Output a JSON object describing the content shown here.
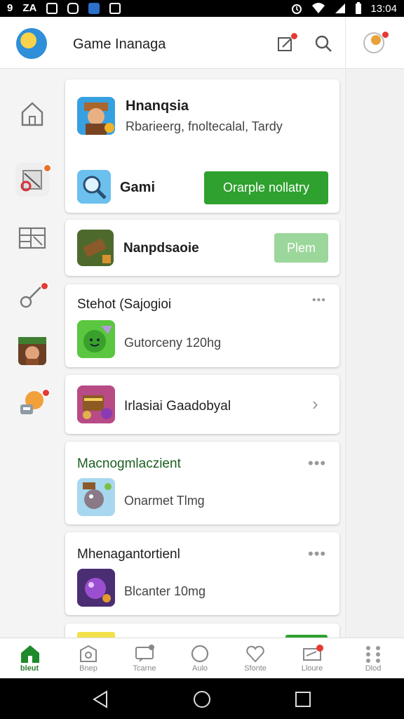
{
  "status_bar": {
    "time": "13:04",
    "left_glyphs": [
      "9",
      "ZA"
    ]
  },
  "app_bar": {
    "title": "Game Inanaga"
  },
  "cards": [
    {
      "title": "Hnanqsia",
      "subtitle": "Rbarieerg, fnoltecalal, Tardy",
      "row2_label": "Gami",
      "button": "Orarple nollatry"
    },
    {
      "title": "Nanpdsaoie",
      "button": "Plem"
    },
    {
      "header": "Stehot (Sajogioi",
      "line": "Gutorceny 120hg"
    },
    {
      "line": "Irlasiai Gaadobyal"
    },
    {
      "header": "Macnogmlaczient",
      "line": "Onarmet Tlmg"
    },
    {
      "header": "Mhenagantortienl",
      "line": "Blcanter 10mg"
    }
  ],
  "bottom_nav": {
    "items": [
      {
        "label": "bleut",
        "icon": "home-icon",
        "active": true
      },
      {
        "label": "Bnep",
        "icon": "store-icon"
      },
      {
        "label": "Tcarne",
        "icon": "message-icon"
      },
      {
        "label": "Aulo",
        "icon": "circle-icon"
      },
      {
        "label": "Sfonte",
        "icon": "heart-icon"
      },
      {
        "label": "Lloure",
        "icon": "inbox-icon"
      },
      {
        "label": "Dlod",
        "icon": "grid-icon"
      }
    ]
  },
  "colors": {
    "accent": "#2ea12f",
    "accent_light": "#9bd79a",
    "badge": "#e53935"
  }
}
